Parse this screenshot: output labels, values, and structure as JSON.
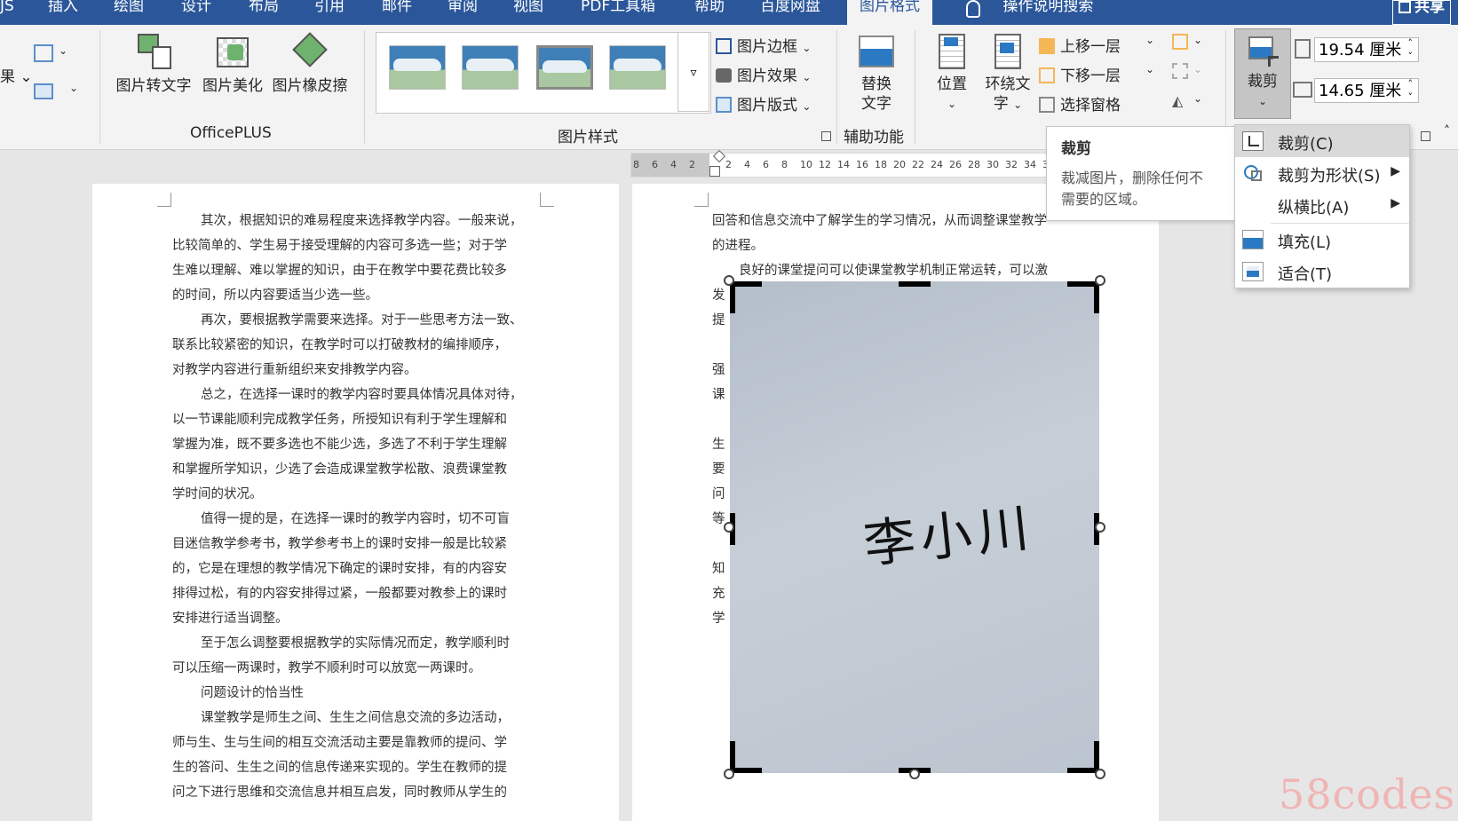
{
  "tabs": [
    {
      "label": "JS"
    },
    {
      "label": "插入"
    },
    {
      "label": "绘图"
    },
    {
      "label": "设计"
    },
    {
      "label": "布局"
    },
    {
      "label": "引用"
    },
    {
      "label": "邮件"
    },
    {
      "label": "审阅"
    },
    {
      "label": "视图"
    },
    {
      "label": "PDF工具箱"
    },
    {
      "label": "帮助"
    },
    {
      "label": "百度网盘"
    },
    {
      "label": "图片格式"
    },
    {
      "label": "操作说明搜索"
    }
  ],
  "share_label": "共享",
  "ribbon": {
    "officeplus": {
      "group_label": "OfficePLUS",
      "buttons": [
        "图片转文字",
        "图片美化",
        "图片橡皮擦"
      ]
    },
    "picture_styles": {
      "group_label": "图片样式",
      "options": [
        "图片边框",
        "图片效果",
        "图片版式"
      ]
    },
    "accessibility": {
      "group_label": "辅助功能",
      "alt_text_line1": "替换",
      "alt_text_line2": "文字"
    },
    "arrange": {
      "position": "位置",
      "wrap_line1": "环绕文",
      "wrap_line2": "字",
      "bring_forward": "上移一层",
      "send_backward": "下移一层",
      "selection_pane": "选择窗格"
    },
    "size": {
      "crop": "裁剪",
      "height": "19.54 厘米",
      "width": "14.65 厘米"
    }
  },
  "ruler": {
    "left_ticks": [
      "8",
      "6",
      "4",
      "2"
    ],
    "right_ticks": [
      "2",
      "4",
      "6",
      "8",
      "10",
      "12",
      "14",
      "16",
      "18",
      "20",
      "22",
      "24",
      "26",
      "28",
      "30",
      "32",
      "34",
      "3"
    ]
  },
  "tooltip": {
    "title": "裁剪",
    "line1": "裁减图片，删除任何不",
    "line2": "需要的区域。"
  },
  "crop_menu": [
    {
      "label": "裁剪(C)",
      "icon": "crop-icon",
      "submenu": false
    },
    {
      "label": "裁剪为形状(S)",
      "icon": "shape-icon",
      "submenu": true
    },
    {
      "label": "纵横比(A)",
      "icon": "",
      "submenu": true
    },
    {
      "label": "填充(L)",
      "icon": "fill-picture-icon",
      "submenu": false
    },
    {
      "label": "适合(T)",
      "icon": "fit-picture-icon",
      "submenu": false
    }
  ],
  "left_page_lines": [
    "其次，根据知识的难易程度来选择教学内容。一般来说，",
    "比较简单的、学生易于接受理解的内容可多选一些；对于学",
    "生难以理解、难以掌握的知识，由于在教学中要花费比较多",
    "的时间，所以内容要适当少选一些。",
    "再次，要根据教学需要来选择。对于一些思考方法一致、",
    "联系比较紧密的知识，在教学时可以打破教材的编排顺序，",
    "对教学内容进行重新组织来安排教学内容。",
    "总之，在选择一课时的教学内容时要具体情况具体对待，",
    "以一节课能顺利完成教学任务，所授知识有利于学生理解和",
    "掌握为准，既不要多选也不能少选，多选了不利于学生理解",
    "和掌握所学知识，少选了会造成课堂教学松散、浪费课堂教",
    "学时间的状况。",
    "值得一提的是，在选择一课时的教学内容时，切不可盲",
    "目迷信教学参考书，教学参考书上的课时安排一般是比较紧",
    "的，它是在理想的教学情况下确定的课时安排，有的内容安",
    "排得过松，有的内容安排得过紧，一般都要对教参上的课时",
    "安排进行适当调整。",
    "至于怎么调整要根据教学的实际情况而定，教学顺利时",
    "可以压缩一两课时，教学不顺利时可以放宽一两课时。",
    "问题设计的恰当性",
    "课堂教学是师生之间、生生之间信息交流的多边活动，",
    "师与生、生与生间的相互交流活动主要是靠教师的提问、学",
    "生的答问、生生之间的信息传递来实现的。学生在教师的提",
    "问之下进行思维和交流信息并相互启发，同时教师从学生的"
  ],
  "right_page_lines": [
    "回答和信息交流中了解学生的学习情况，从而调整课堂教学",
    "的进程。",
    "良好的课堂提问可以使课堂教学机制正常运转，可以激",
    "发",
    "提",
    "",
    "强",
    "课",
    "",
    "生",
    "要",
    "问",
    "等",
    "",
    "知",
    "充",
    "学"
  ],
  "signature_text": "李小川",
  "watermark": "58codes"
}
